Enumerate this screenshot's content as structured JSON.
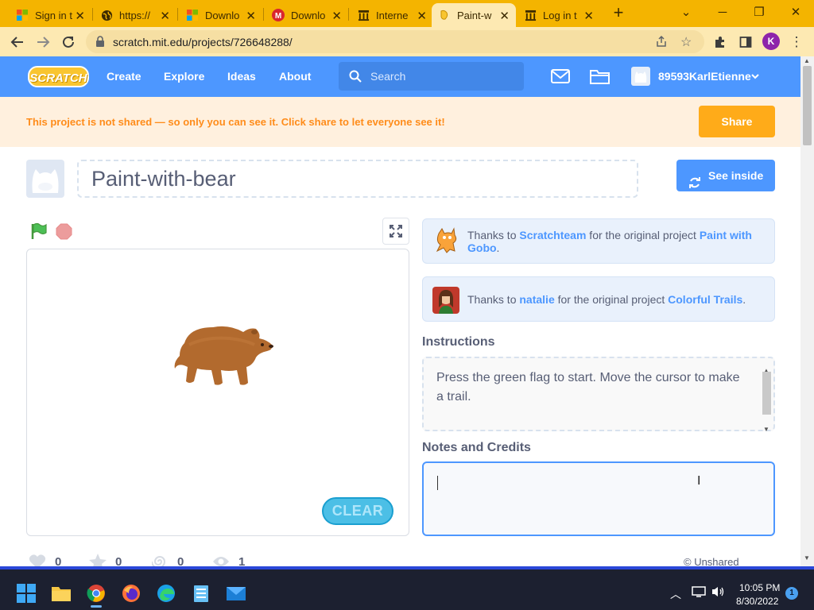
{
  "browser": {
    "tabs": [
      {
        "title": "Sign in t",
        "icon": "microsoft-icon"
      },
      {
        "title": "https://",
        "icon": "globe-icon"
      },
      {
        "title": "Downlo",
        "icon": "microsoft-icon"
      },
      {
        "title": "Downlo",
        "icon": "mega-icon"
      },
      {
        "title": "Interne",
        "icon": "archive-icon"
      },
      {
        "title": "Paint-w",
        "icon": "scratch-icon",
        "active": true
      },
      {
        "title": "Log in t",
        "icon": "archive-icon"
      }
    ],
    "url": "scratch.mit.edu/projects/726648288/",
    "profile_initial": "K",
    "accent_color": "#f4b400"
  },
  "scratch_nav": {
    "logo_text": "SCRATCH",
    "links": [
      "Create",
      "Explore",
      "Ideas",
      "About"
    ],
    "search_placeholder": "Search",
    "username": "89593KarlEtienne"
  },
  "banner": {
    "message": "This project is not shared — so only you can see it. Click share to let everyone see it!",
    "share_label": "Share"
  },
  "project": {
    "title": "Paint-with-bear",
    "see_inside_label": "See inside",
    "clear_label": "CLEAR"
  },
  "credits": [
    {
      "prefix": "Thanks to ",
      "user": "Scratchteam",
      "middle": " for the original project ",
      "project": "Paint with Gobo",
      "suffix": "."
    },
    {
      "prefix": "Thanks to ",
      "user": "natalie",
      "middle": " for the original project ",
      "project": "Colorful Trails",
      "suffix": "."
    }
  ],
  "instructions": {
    "heading": "Instructions",
    "text": "Press the green flag to start. Move the cursor to make a trail."
  },
  "notes": {
    "heading": "Notes and Credits",
    "value": ""
  },
  "stats": {
    "loves": "0",
    "favorites": "0",
    "remixes": "0",
    "views": "1",
    "sharing_status": "© Unshared"
  },
  "taskbar": {
    "time": "10:05 PM",
    "date": "8/30/2022",
    "notification_count": "1"
  }
}
